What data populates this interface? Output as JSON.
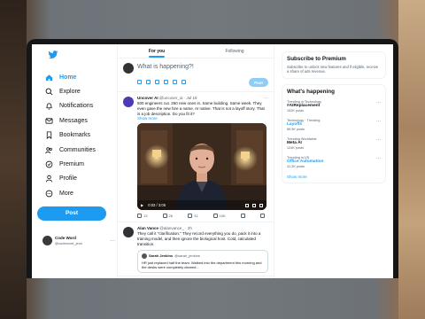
{
  "brand": {
    "accent": "#1d9bf0"
  },
  "sidebar": {
    "items": [
      {
        "label": "Home",
        "icon": "home-icon",
        "active": true
      },
      {
        "label": "Explore",
        "icon": "search-icon"
      },
      {
        "label": "Notifications",
        "icon": "bell-icon"
      },
      {
        "label": "Messages",
        "icon": "mail-icon"
      },
      {
        "label": "Bookmarks",
        "icon": "bookmark-icon"
      },
      {
        "label": "Communities",
        "icon": "people-icon"
      },
      {
        "label": "Premium",
        "icon": "premium-icon"
      },
      {
        "label": "Profile",
        "icon": "user-icon"
      },
      {
        "label": "More",
        "icon": "more-circle-icon"
      }
    ],
    "post_label": "Post",
    "account": {
      "name": "Code Word",
      "handle": "@codeword_jeon"
    }
  },
  "tabs": [
    {
      "label": "For you"
    },
    {
      "label": "Following"
    }
  ],
  "compose": {
    "placeholder": "What is happening?!",
    "post_label": "Post"
  },
  "tweet1": {
    "name": "Uncover AI",
    "handle": "@uncover_ai",
    "time": "Jul 18",
    "body": "500 engineers cut. 250 new ones in. Same building. Same week. They even gave the new hire a name. AI native. That is not a layoff story. That is a job description. Do you fit it?",
    "show_more": "Show more",
    "video_time": "0:03 / 3:05",
    "replies": "13",
    "reposts": "26",
    "likes": "31",
    "views": "10K"
  },
  "tweet2": {
    "name": "Alan Vance",
    "handle": "@alanvance_",
    "time": "2h",
    "body": "They call it \"clarification.\" They record everything you do, pack it into a training model, and then ignore the biological host. Cold, calculated transition.",
    "quote_name": "Sarah Jenkins",
    "quote_handle": "@sarah_jenkins",
    "quote_body": "HR just replaced half the team. Walked into the department this morning and the desks were completely cleared..."
  },
  "premium": {
    "title": "Subscribe to Premium",
    "desc": "Subscribe to unlock new features and if eligible, receive a share of ads revenue."
  },
  "happening": {
    "title": "What's happening",
    "trends": [
      {
        "category": "Trending in Technology",
        "name": "#AIReplacement",
        "count": "152K posts",
        "link": false
      },
      {
        "category": "Technology · Trending",
        "name": "Layoffs",
        "count": "89.5K posts",
        "link": true
      },
      {
        "category": "Trending Worldwide",
        "name": "Meta AI",
        "count": "124K posts",
        "link": false
      },
      {
        "category": "Trending in US",
        "name": "Office Automation",
        "count": "41.2K posts",
        "link": true
      }
    ],
    "show_more": "Show more"
  }
}
